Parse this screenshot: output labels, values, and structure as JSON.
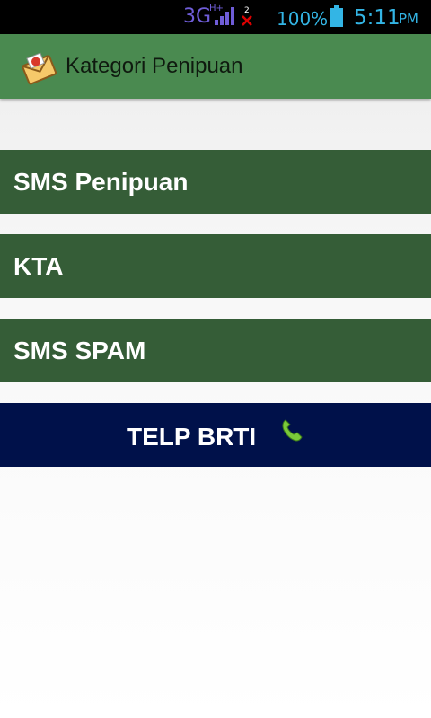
{
  "status_bar": {
    "network": "3G",
    "network_sub": "H+",
    "sim_count": "2",
    "battery_pct": "100%",
    "time": "5:11",
    "ampm": "PM"
  },
  "action_bar": {
    "title": "Kategori Penipuan",
    "icon": "envelope-icon"
  },
  "menu": {
    "items": [
      {
        "label": "SMS Penipuan"
      },
      {
        "label": "KTA"
      },
      {
        "label": "SMS SPAM"
      }
    ],
    "call_button": {
      "label": "TELP BRTI",
      "icon": "phone-icon"
    }
  },
  "colors": {
    "action_bar": "#4a8a50",
    "menu_item": "#355d37",
    "call_button": "#00114a",
    "status_text": "#33b5e5"
  }
}
